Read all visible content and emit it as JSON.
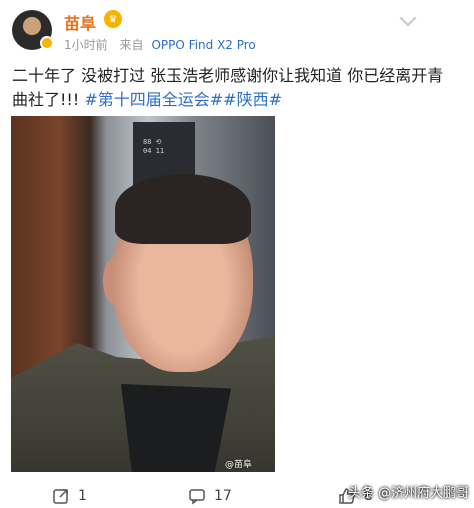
{
  "post": {
    "author": "苗阜",
    "time": "1小时前",
    "source_prefix": "来自",
    "source_device": "OPPO Find X2 Pro",
    "text": "二十年了 没被打过 张玉浩老师感谢你让我知道 你已经离开青曲社了!!! ",
    "hashtags": [
      "#第十四届全运会#",
      "#陕西#"
    ],
    "photo_watermark": "@苗阜"
  },
  "actions": {
    "repost_count": "1",
    "comment_count": "17",
    "like_count": "8"
  },
  "overlay_watermark": "头条 @济州府大鹏哥",
  "colors": {
    "author": "#e8711a",
    "link": "#2f6ec8",
    "meta": "#999999"
  },
  "icons": {
    "vip": "vip-crown-icon",
    "menu": "chevron-down-icon",
    "repost": "repost-icon",
    "comment": "comment-icon",
    "like": "thumbs-up-icon"
  }
}
